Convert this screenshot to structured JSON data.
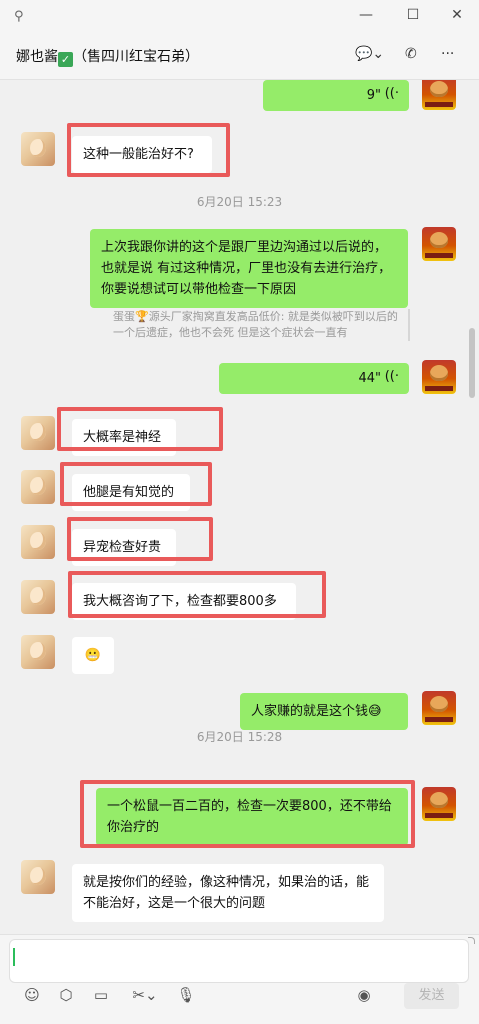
{
  "window": {
    "pin_icon": "⚲",
    "minimize_icon": "—",
    "maximize_icon": "☐",
    "close_icon": "✕"
  },
  "header": {
    "title": "娜也酱",
    "verified_mark": "✓",
    "subtitle": "（售四川红宝石弟）",
    "chat_icon": "💬⌄",
    "call_icon": "✆",
    "more_icon": "···"
  },
  "messages": [
    {
      "side": "right",
      "type": "voice",
      "duration": "9\"",
      "wave": "((·"
    },
    {
      "side": "left",
      "text": "这种一般能治好不?"
    },
    {
      "type": "time",
      "text": "6月20日 15:23"
    },
    {
      "side": "right",
      "text": "上次我跟你讲的这个是跟厂里边沟通过以后说的，也就是说 有过这种情况，厂里也没有去进行治疗，你要说想试可以带他检查一下原因"
    },
    {
      "type": "quote",
      "text": "蛋蛋🏆源头厂家掏窝直发高品低价: 就是类似被吓到以后的一个后遗症，他也不会死 但是这个症状会一直有"
    },
    {
      "side": "right",
      "type": "voice",
      "duration": "44\"",
      "wave": "((·"
    },
    {
      "side": "left",
      "text": "大概率是神经"
    },
    {
      "side": "left",
      "text": "他腿是有知觉的"
    },
    {
      "side": "left",
      "text": "异宠检查好贵"
    },
    {
      "side": "left",
      "text": "我大概咨询了下，检查都要800多"
    },
    {
      "side": "left",
      "text": "😬"
    },
    {
      "side": "right",
      "text": "人家赚的就是这个钱😅"
    },
    {
      "type": "time",
      "text": "6月20日 15:28"
    },
    {
      "side": "right",
      "text": "一个松鼠一百二百的，检查一次要800，还不带给你治疗的"
    },
    {
      "side": "left",
      "text": "就是按你们的经验，像这种情况，如果治的话，能不能治好，这是一个很大的问题"
    }
  ],
  "input": {
    "value": "",
    "toolbar": {
      "emoji_icon": "☺",
      "favorites_icon": "⬡",
      "folder_icon": "▭",
      "scissors_icon": "✂⌄",
      "mic_icon": "🎙",
      "voice_input_icon": "◉"
    },
    "send_label": "发送"
  }
}
